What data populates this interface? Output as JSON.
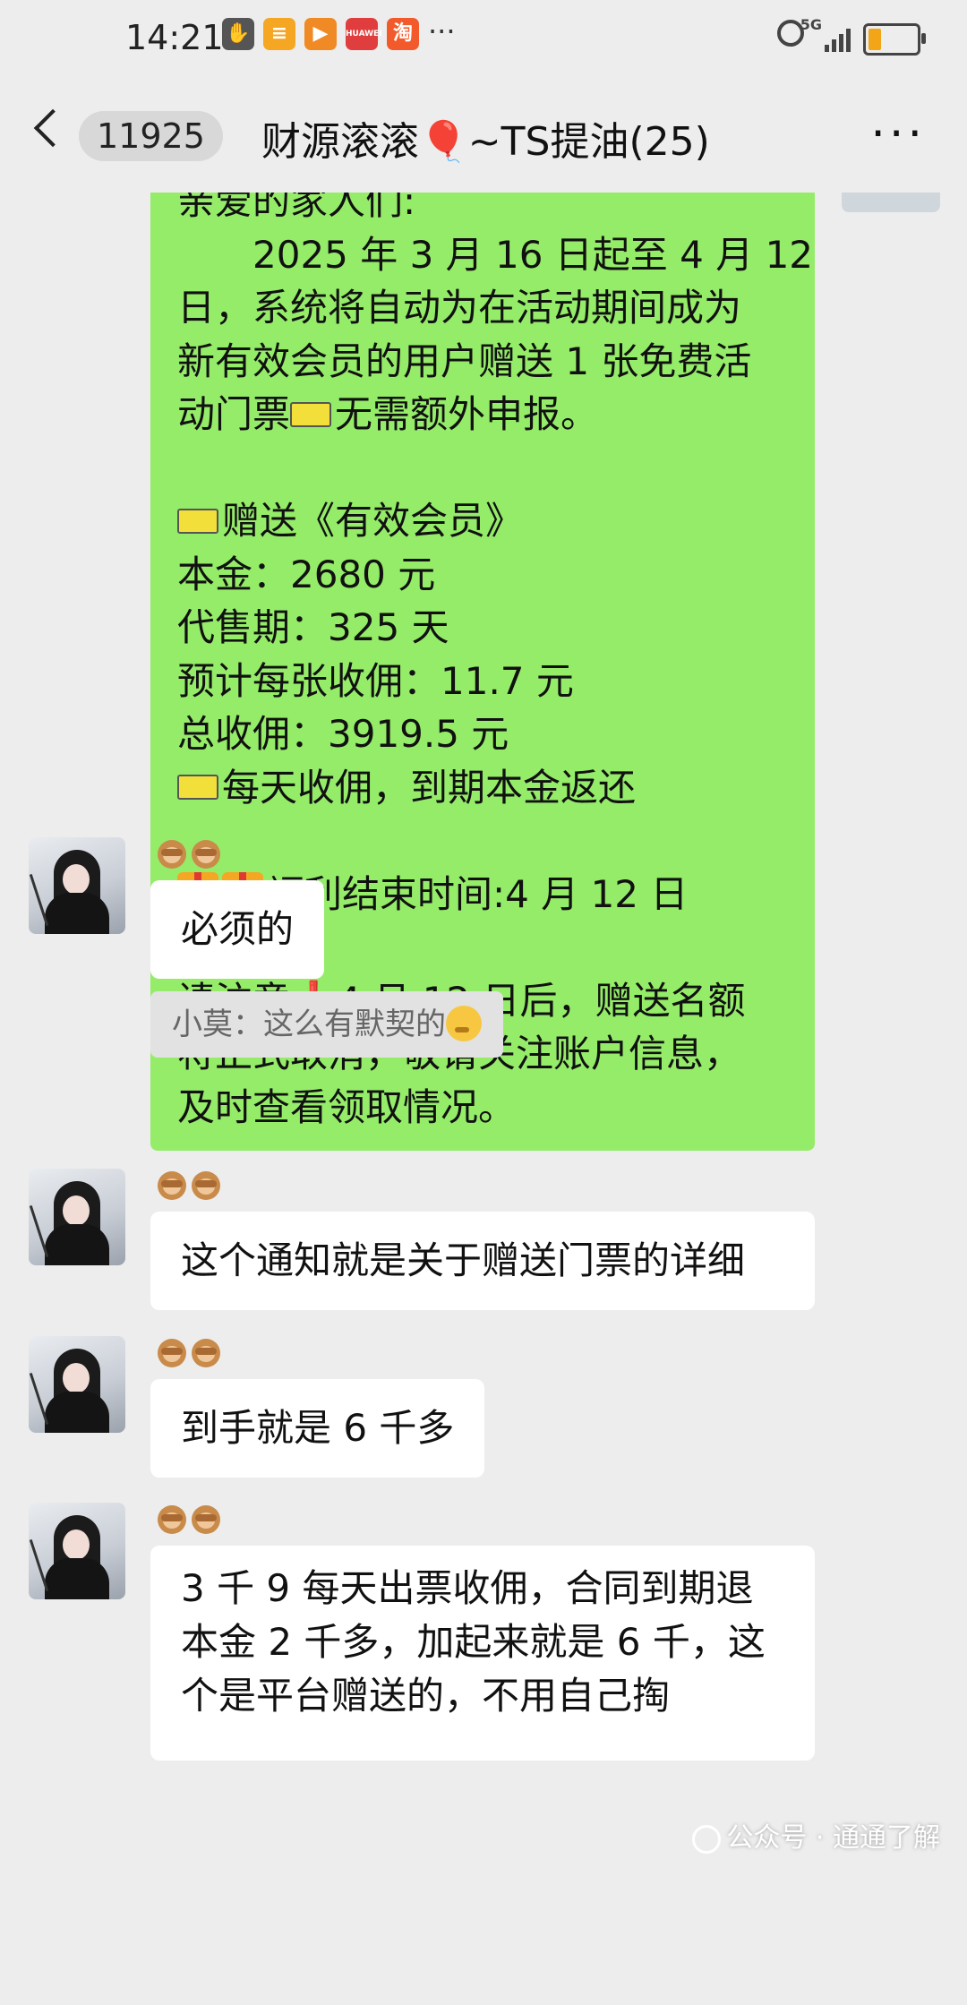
{
  "status_bar": {
    "time": "14:21",
    "more": "···",
    "network": "5G",
    "apps": [
      {
        "name": "hand-icon",
        "color": "#555555"
      },
      {
        "name": "app-orange-icon",
        "color": "#f5a623"
      },
      {
        "name": "video-icon",
        "color": "#f08a24"
      },
      {
        "name": "huawei-icon",
        "color": "#e03e3e",
        "label": "HUAWEI"
      },
      {
        "name": "taobao-icon",
        "color": "#f25a2c",
        "label": "淘"
      }
    ]
  },
  "nav": {
    "unread_count": "11925",
    "title": "财源滚滚🎈~TS提油(25)",
    "more_label": "···"
  },
  "notice": {
    "lines": [
      "亲爱的家人们:",
      "　　2025 年 3 月 16 日起至 4 月 12",
      "日，系统将自动为在活动期间成为",
      "新有效会员的用户赠送 1 张免费活",
      "动门票",
      "无需额外申报。",
      "赠送《有效会员》",
      "本金：2680 元",
      "代售期：325 天",
      "预计每张收佣：11.7 元",
      "总收佣：3919.5 元",
      "每天收佣，到期本金返还",
      "福利结束时间:4 月 12 日",
      "请注意",
      "4 月 12 日后，赠送名额",
      "将正式取消，敬请关注账户信息，",
      "及时查看领取情况。"
    ],
    "exclamation": "❗"
  },
  "messages": [
    {
      "text": "必须的"
    },
    {
      "text": "这个通知就是关于赠送门票的详细"
    },
    {
      "text": "到手就是 6 千多"
    },
    {
      "lines": [
        "3 千 9 每天出票收佣，合同到期退",
        "本金 2 千多，加起来就是 6 千，这",
        "个是平台赠送的，不用自己掏"
      ]
    }
  ],
  "system_message": "小莫：这么有默契的",
  "watermark": "公众号 · 通通了解"
}
